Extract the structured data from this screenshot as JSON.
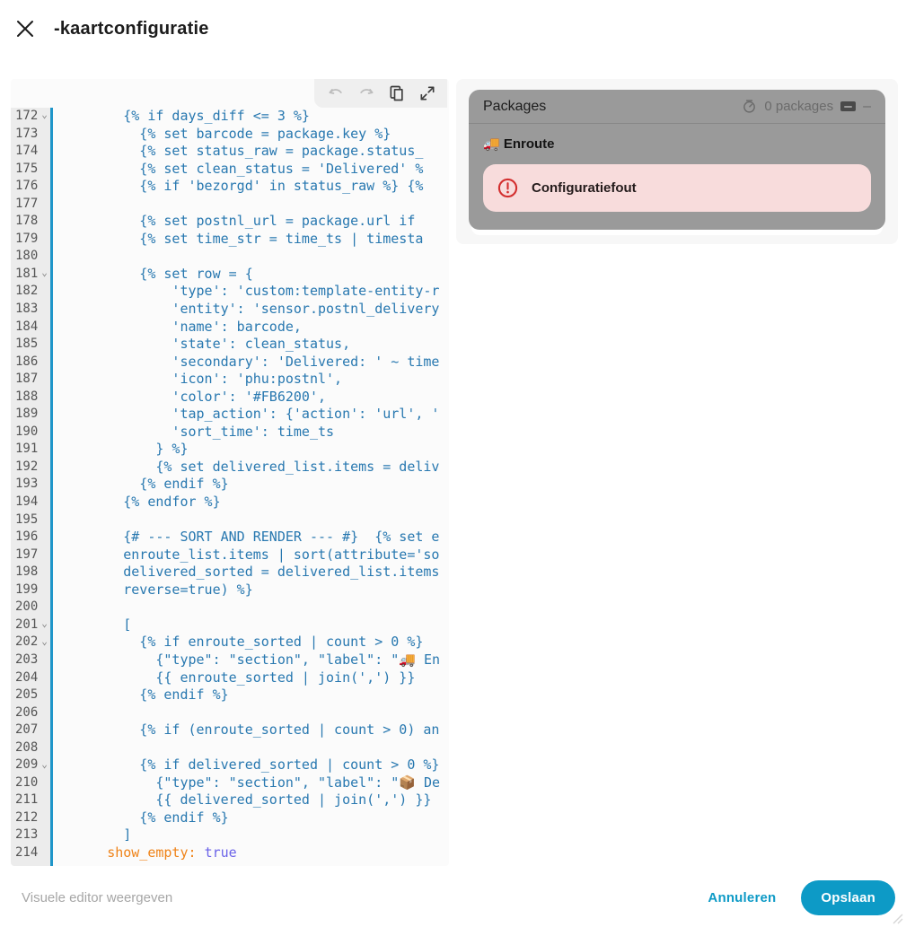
{
  "dialog": {
    "title": "-kaartconfiguratie"
  },
  "colors": {
    "accent": "#0d9ac6",
    "code_blue": "#2878b0",
    "yaml_key_orange": "#ef8318",
    "yaml_atom_purple": "#6b63e8",
    "error_red": "#d32f2f",
    "error_bg_pink": "#f8dcdc",
    "card_gray": "#9a9a9a",
    "icon_color_in_code": "#FB6200"
  },
  "editor": {
    "lines": [
      {
        "n": 172,
        "f": true,
        "s": [
          [
            "j",
            "        {% if days_diff <= 3 %}"
          ]
        ]
      },
      {
        "n": 173,
        "f": false,
        "s": [
          [
            "j",
            "          {% set barcode = package.key %}"
          ]
        ]
      },
      {
        "n": 174,
        "f": false,
        "s": [
          [
            "j",
            "          {% set status_raw = package.status_"
          ]
        ]
      },
      {
        "n": 175,
        "f": false,
        "s": [
          [
            "j",
            "          {% set clean_status = 'Delivered' %"
          ]
        ]
      },
      {
        "n": 176,
        "f": false,
        "s": [
          [
            "j",
            "          {% if 'bezorgd' in status_raw %} {%"
          ]
        ]
      },
      {
        "n": 177,
        "f": false,
        "s": []
      },
      {
        "n": 178,
        "f": false,
        "s": [
          [
            "j",
            "          {% set postnl_url = package.url if "
          ]
        ]
      },
      {
        "n": 179,
        "f": false,
        "s": [
          [
            "j",
            "          {% set time_str = time_ts | timesta"
          ]
        ]
      },
      {
        "n": 180,
        "f": false,
        "s": []
      },
      {
        "n": 181,
        "f": true,
        "s": [
          [
            "j",
            "          {% set row = {"
          ]
        ]
      },
      {
        "n": 182,
        "f": false,
        "s": [
          [
            "j",
            "              'type': 'custom:template-entity-r"
          ]
        ]
      },
      {
        "n": 183,
        "f": false,
        "s": [
          [
            "j",
            "              'entity': 'sensor.postnl_delivery"
          ]
        ]
      },
      {
        "n": 184,
        "f": false,
        "s": [
          [
            "j",
            "              'name': barcode,"
          ]
        ]
      },
      {
        "n": 185,
        "f": false,
        "s": [
          [
            "j",
            "              'state': clean_status,"
          ]
        ]
      },
      {
        "n": 186,
        "f": false,
        "s": [
          [
            "j",
            "              'secondary': 'Delivered: ' ~ time"
          ]
        ]
      },
      {
        "n": 187,
        "f": false,
        "s": [
          [
            "j",
            "              'icon': 'phu:postnl',"
          ]
        ]
      },
      {
        "n": 188,
        "f": false,
        "s": [
          [
            "j",
            "              'color': '#FB6200',"
          ]
        ]
      },
      {
        "n": 189,
        "f": false,
        "s": [
          [
            "j",
            "              'tap_action': {'action': 'url', '"
          ]
        ]
      },
      {
        "n": 190,
        "f": false,
        "s": [
          [
            "j",
            "              'sort_time': time_ts"
          ]
        ]
      },
      {
        "n": 191,
        "f": false,
        "s": [
          [
            "j",
            "            } %}"
          ]
        ]
      },
      {
        "n": 192,
        "f": false,
        "s": [
          [
            "j",
            "            {% set delivered_list.items = deliv"
          ]
        ]
      },
      {
        "n": 193,
        "f": false,
        "s": [
          [
            "j",
            "          {% endif %}"
          ]
        ]
      },
      {
        "n": 194,
        "f": false,
        "s": [
          [
            "j",
            "        {% endfor %}"
          ]
        ]
      },
      {
        "n": 195,
        "f": false,
        "s": []
      },
      {
        "n": 196,
        "f": false,
        "s": [
          [
            "j",
            "        {# --- SORT AND RENDER --- #}  {% set e"
          ]
        ]
      },
      {
        "n": 197,
        "f": false,
        "s": [
          [
            "j",
            "        enroute_list.items | sort(attribute='so"
          ]
        ]
      },
      {
        "n": 198,
        "f": false,
        "s": [
          [
            "j",
            "        delivered_sorted = delivered_list.items"
          ]
        ]
      },
      {
        "n": 199,
        "f": false,
        "s": [
          [
            "j",
            "        reverse=true) %}"
          ]
        ]
      },
      {
        "n": 200,
        "f": false,
        "s": []
      },
      {
        "n": 201,
        "f": true,
        "s": [
          [
            "j",
            "        ["
          ]
        ]
      },
      {
        "n": 202,
        "f": true,
        "s": [
          [
            "j",
            "          {% if enroute_sorted | count > 0 %}"
          ]
        ]
      },
      {
        "n": 203,
        "f": false,
        "s": [
          [
            "j",
            "            {\"type\": \"section\", \"label\": \"🚚 En"
          ]
        ]
      },
      {
        "n": 204,
        "f": false,
        "s": [
          [
            "j",
            "            {{ enroute_sorted | join(',') }}"
          ]
        ]
      },
      {
        "n": 205,
        "f": false,
        "s": [
          [
            "j",
            "          {% endif %}"
          ]
        ]
      },
      {
        "n": 206,
        "f": false,
        "s": []
      },
      {
        "n": 207,
        "f": false,
        "s": [
          [
            "j",
            "          {% if (enroute_sorted | count > 0) an"
          ]
        ]
      },
      {
        "n": 208,
        "f": false,
        "s": []
      },
      {
        "n": 209,
        "f": true,
        "s": [
          [
            "j",
            "          {% if delivered_sorted | count > 0 %}"
          ]
        ]
      },
      {
        "n": 210,
        "f": false,
        "s": [
          [
            "j",
            "            {\"type\": \"section\", \"label\": \"📦 De"
          ]
        ]
      },
      {
        "n": 211,
        "f": false,
        "s": [
          [
            "j",
            "            {{ delivered_sorted | join(',') }}"
          ]
        ]
      },
      {
        "n": 212,
        "f": false,
        "s": [
          [
            "j",
            "          {% endif %}"
          ]
        ]
      },
      {
        "n": 213,
        "f": false,
        "s": [
          [
            "j",
            "        ]"
          ]
        ]
      },
      {
        "n": 214,
        "f": false,
        "s": [
          [
            "p",
            "      "
          ],
          [
            "k",
            "show_empty:"
          ],
          [
            "p",
            " "
          ],
          [
            "a",
            "true"
          ]
        ]
      }
    ]
  },
  "preview": {
    "card_title": "Packages",
    "count_label": "0 packages",
    "section_label": "🚚 Enroute",
    "error_label": "Configuratiefout"
  },
  "footer": {
    "visual_editor_label": "Visuele editor weergeven",
    "cancel_label": "Annuleren",
    "save_label": "Opslaan"
  }
}
